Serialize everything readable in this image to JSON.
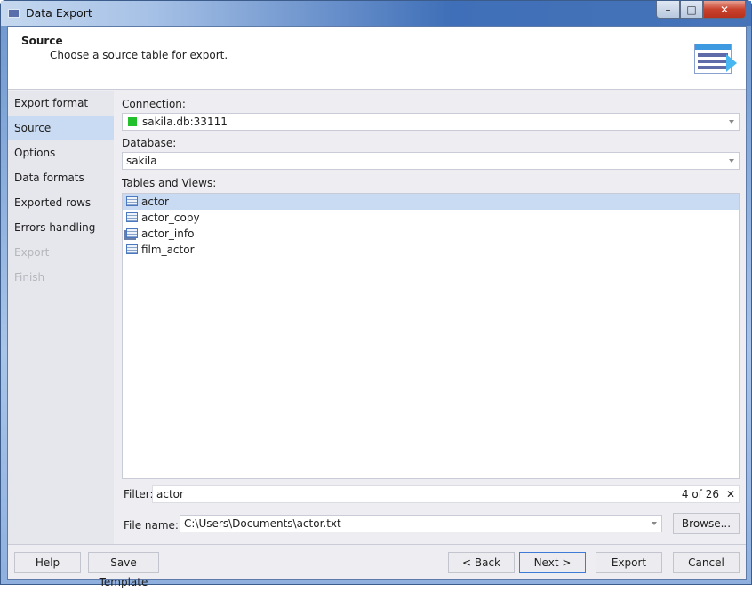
{
  "window": {
    "title": "Data Export",
    "minimize": "–",
    "maximize": "□",
    "close": "✕"
  },
  "header": {
    "title": "Source",
    "subtitle": "Choose a source table for export."
  },
  "nav": {
    "items": [
      {
        "label": "Export format"
      },
      {
        "label": "Source"
      },
      {
        "label": "Options"
      },
      {
        "label": "Data formats"
      },
      {
        "label": "Exported rows"
      },
      {
        "label": "Errors handling"
      },
      {
        "label": "Export"
      },
      {
        "label": "Finish"
      }
    ]
  },
  "source": {
    "connection_label": "Connection:",
    "connection_value": "sakila.db:33111",
    "connection_color": "#22c02a",
    "database_label": "Database:",
    "database_value": "sakila",
    "tables_label": "Tables and Views:",
    "tables": [
      {
        "name": "actor",
        "kind": "table"
      },
      {
        "name": "actor_copy",
        "kind": "table"
      },
      {
        "name": "actor_info",
        "kind": "view"
      },
      {
        "name": "film_actor",
        "kind": "table"
      }
    ],
    "filter_label": "Filter:",
    "filter_value": "actor",
    "filter_count": "4 of 26",
    "filter_clear": "✕",
    "filename_label": "File name:",
    "filename_value": "C:\\Users\\Documents\\actor.txt",
    "browse": "Browse..."
  },
  "footer": {
    "help": "Help",
    "save_template": "Save Template",
    "back": "< Back",
    "next": "Next >",
    "export": "Export",
    "cancel": "Cancel"
  }
}
